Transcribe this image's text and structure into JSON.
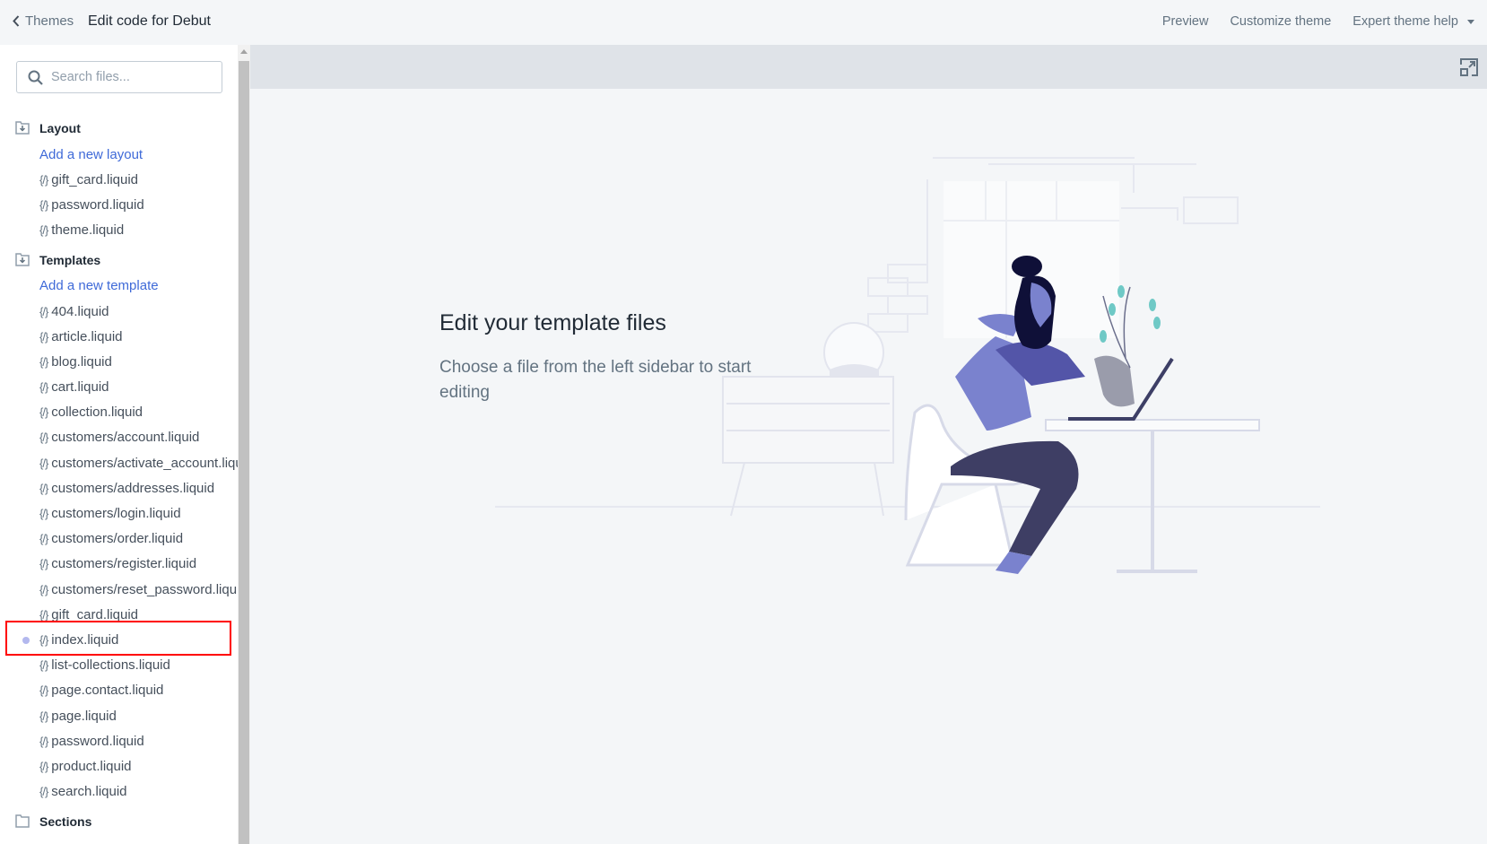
{
  "topbar": {
    "back_label": "Themes",
    "title_prefix": "Edit code for",
    "theme_name": "Debut",
    "nav": [
      "Preview",
      "Customize theme",
      "Expert theme help"
    ]
  },
  "sidebar": {
    "search_placeholder": "Search files...",
    "layout": {
      "heading": "Layout",
      "add_link": "Add a new layout",
      "files": [
        "gift_card.liquid",
        "password.liquid",
        "theme.liquid"
      ]
    },
    "templates": {
      "heading": "Templates",
      "add_link": "Add a new template",
      "files": [
        "404.liquid",
        "article.liquid",
        "blog.liquid",
        "cart.liquid",
        "collection.liquid",
        "customers/account.liquid",
        "customers/activate_account.liquid",
        "customers/addresses.liquid",
        "customers/login.liquid",
        "customers/order.liquid",
        "customers/register.liquid",
        "customers/reset_password.liquid",
        "gift_card.liquid",
        "index.liquid",
        "list-collections.liquid",
        "page.contact.liquid",
        "page.liquid",
        "password.liquid",
        "product.liquid",
        "search.liquid"
      ],
      "modified_file": "index.liquid"
    },
    "sections": {
      "heading": "Sections"
    },
    "file_icon": "{/}"
  },
  "main": {
    "empty_title": "Edit your template files",
    "empty_subtitle": "Choose a file from the left sidebar to start editing"
  },
  "colors": {
    "link": "#3f6ad8",
    "highlight": "#ff0000",
    "modified_dot": "#b3b8ee",
    "illustration_primary": "#7a82ce"
  }
}
